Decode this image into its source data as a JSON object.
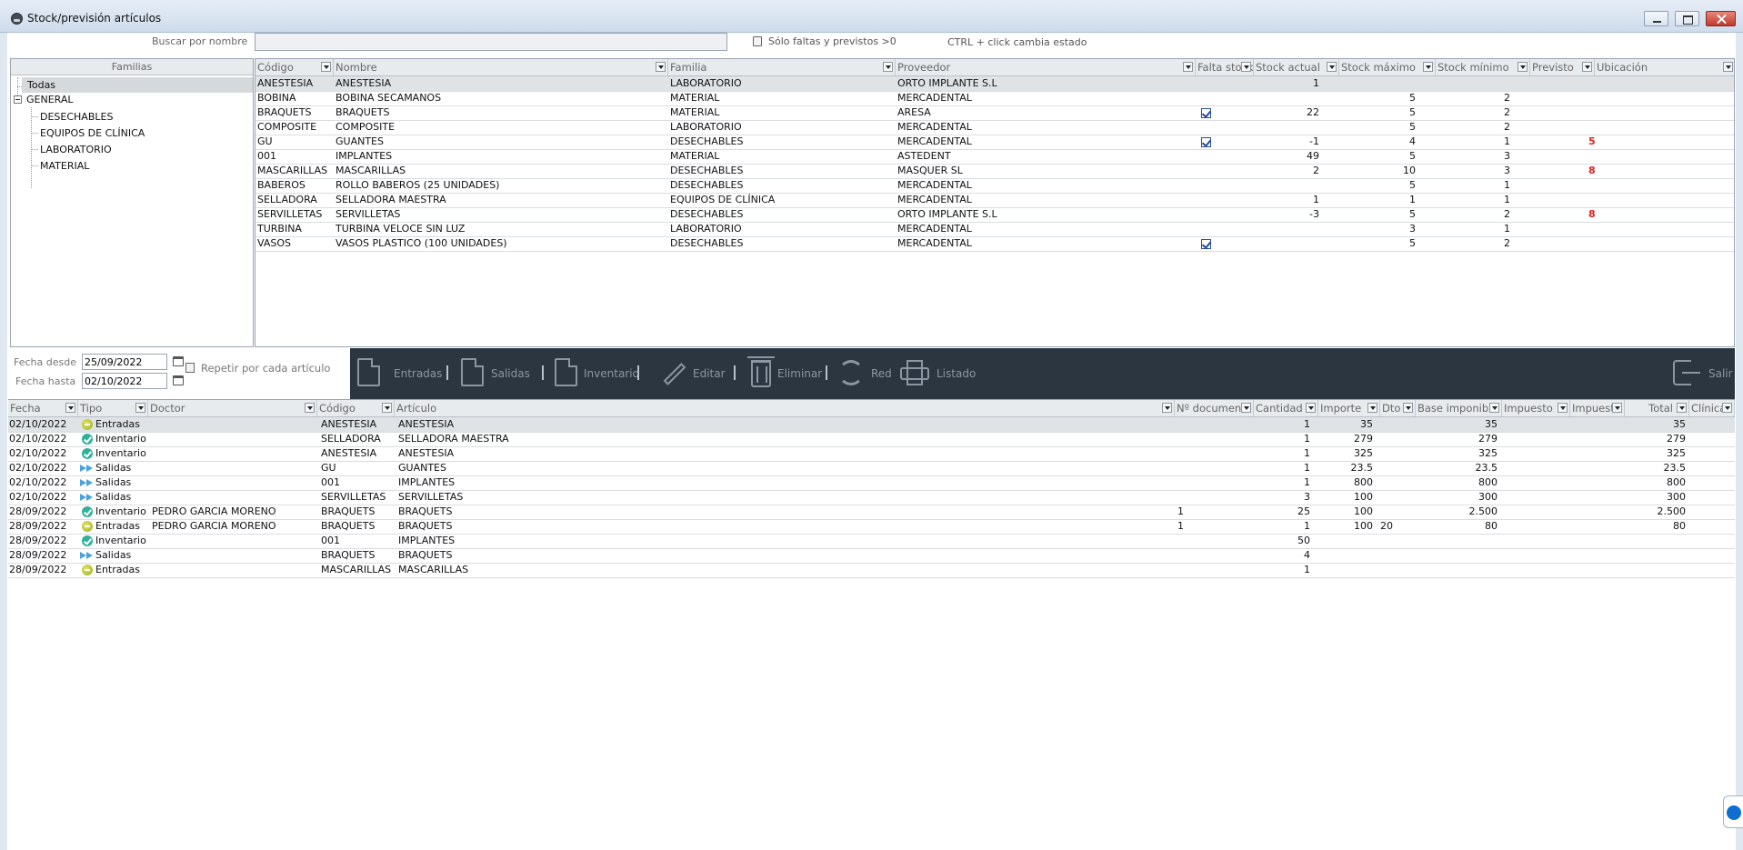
{
  "window": {
    "title": "Stock/previsión artículos"
  },
  "search": {
    "label": "Buscar por nombre",
    "value": "",
    "placeholder": ""
  },
  "filter_faltas_label": "Sólo faltas y previstos >0",
  "ctrl_hint": "CTRL + click cambia estado",
  "families": {
    "header": "Familias",
    "todas": "Todas",
    "general": "GENERAL",
    "children": [
      "DESECHABLES",
      "EQUIPOS DE CLÍNICA",
      "LABORATORIO",
      "MATERIAL"
    ]
  },
  "stock_table": {
    "columns": [
      "Código",
      "Nombre",
      "Familia",
      "Proveedor",
      "Falta stock",
      "Stock actual",
      "Stock máximo",
      "Stock mínimo",
      "Previsto",
      "Ubicación"
    ],
    "rows": [
      {
        "codigo": "ANESTESIA",
        "nombre": "ANESTESIA",
        "familia": "LABORATORIO",
        "proveedor": "ORTO IMPLANTE S.L",
        "falta": false,
        "actual": "1",
        "maximo": "",
        "minimo": "",
        "previsto": ""
      },
      {
        "codigo": "BOBINA",
        "nombre": "BOBINA SECAMANOS",
        "familia": "MATERIAL",
        "proveedor": "MERCADENTAL",
        "falta": false,
        "actual": "",
        "maximo": "5",
        "minimo": "2",
        "previsto": ""
      },
      {
        "codigo": "BRAQUETS",
        "nombre": "BRAQUETS",
        "familia": "MATERIAL",
        "proveedor": "ARESA",
        "falta": true,
        "actual": "22",
        "maximo": "5",
        "minimo": "2",
        "previsto": ""
      },
      {
        "codigo": "COMPOSITE",
        "nombre": "COMPOSITE",
        "familia": "LABORATORIO",
        "proveedor": "MERCADENTAL",
        "falta": false,
        "actual": "",
        "maximo": "5",
        "minimo": "2",
        "previsto": ""
      },
      {
        "codigo": "GU",
        "nombre": "GUANTES",
        "familia": "DESECHABLES",
        "proveedor": "MERCADENTAL",
        "falta": true,
        "actual": "-1",
        "maximo": "4",
        "minimo": "1",
        "previsto": "5"
      },
      {
        "codigo": "001",
        "nombre": "IMPLANTES",
        "familia": "MATERIAL",
        "proveedor": "ASTEDENT",
        "falta": false,
        "actual": "49",
        "maximo": "5",
        "minimo": "3",
        "previsto": ""
      },
      {
        "codigo": "MASCARILLAS",
        "nombre": "MASCARILLAS",
        "familia": "DESECHABLES",
        "proveedor": "MASQUER SL",
        "falta": false,
        "actual": "2",
        "maximo": "10",
        "minimo": "3",
        "previsto": "8"
      },
      {
        "codigo": "BABEROS",
        "nombre": "ROLLO BABEROS (25 UNIDADES)",
        "familia": "DESECHABLES",
        "proveedor": "MERCADENTAL",
        "falta": false,
        "actual": "",
        "maximo": "5",
        "minimo": "1",
        "previsto": ""
      },
      {
        "codigo": "SELLADORA",
        "nombre": "SELLADORA MAESTRA",
        "familia": "EQUIPOS DE CLÍNICA",
        "proveedor": "MERCADENTAL",
        "falta": false,
        "actual": "1",
        "maximo": "1",
        "minimo": "1",
        "previsto": ""
      },
      {
        "codigo": "SERVILLETAS",
        "nombre": "SERVILLETAS",
        "familia": "DESECHABLES",
        "proveedor": "ORTO IMPLANTE S.L",
        "falta": false,
        "actual": "-3",
        "maximo": "5",
        "minimo": "2",
        "previsto": "8"
      },
      {
        "codigo": "TURBINA",
        "nombre": "TURBINA VELOCE SIN LUZ",
        "familia": "LABORATORIO",
        "proveedor": "MERCADENTAL",
        "falta": false,
        "actual": "",
        "maximo": "3",
        "minimo": "1",
        "previsto": ""
      },
      {
        "codigo": "VASOS",
        "nombre": "VASOS PLASTICO (100 UNIDADES)",
        "familia": "DESECHABLES",
        "proveedor": "MERCADENTAL",
        "falta": true,
        "actual": "",
        "maximo": "5",
        "minimo": "2",
        "previsto": ""
      }
    ]
  },
  "filters": {
    "desde_label": "Fecha desde",
    "desde_value": "25/09/2022",
    "hasta_label": "Fecha hasta",
    "hasta_value": "02/10/2022",
    "repetir_label": "Repetir por cada artículo"
  },
  "toolbar": {
    "entradas": "Entradas",
    "salidas": "Salidas",
    "inventario": "Inventario",
    "editar": "Editar",
    "eliminar": "Eliminar",
    "red": "Red",
    "listado": "Listado",
    "salir": "Salir"
  },
  "movements_table": {
    "columns": [
      "Fecha",
      "Tipo",
      "Doctor",
      "Código",
      "Artículo",
      "Nº documento",
      "Cantidad",
      "Importe",
      "Dto",
      "Base imponible",
      "Impuesto",
      "Impuesto",
      "Total",
      "Clínica"
    ],
    "rows": [
      {
        "fecha": "02/10/2022",
        "tipo": "Entradas",
        "doctor": "",
        "codigo": "ANESTESIA",
        "articulo": "ANESTESIA",
        "doc": "",
        "cantidad": "1",
        "importe": "35",
        "dto": "",
        "base": "35",
        "total": "35"
      },
      {
        "fecha": "02/10/2022",
        "tipo": "Inventario",
        "doctor": "",
        "codigo": "SELLADORA",
        "articulo": "SELLADORA MAESTRA",
        "doc": "",
        "cantidad": "1",
        "importe": "279",
        "dto": "",
        "base": "279",
        "total": "279"
      },
      {
        "fecha": "02/10/2022",
        "tipo": "Inventario",
        "doctor": "",
        "codigo": "ANESTESIA",
        "articulo": "ANESTESIA",
        "doc": "",
        "cantidad": "1",
        "importe": "325",
        "dto": "",
        "base": "325",
        "total": "325"
      },
      {
        "fecha": "02/10/2022",
        "tipo": "Salidas",
        "doctor": "",
        "codigo": "GU",
        "articulo": "GUANTES",
        "doc": "",
        "cantidad": "1",
        "importe": "23.5",
        "dto": "",
        "base": "23.5",
        "total": "23.5"
      },
      {
        "fecha": "02/10/2022",
        "tipo": "Salidas",
        "doctor": "",
        "codigo": "001",
        "articulo": "IMPLANTES",
        "doc": "",
        "cantidad": "1",
        "importe": "800",
        "dto": "",
        "base": "800",
        "total": "800"
      },
      {
        "fecha": "02/10/2022",
        "tipo": "Salidas",
        "doctor": "",
        "codigo": "SERVILLETAS",
        "articulo": "SERVILLETAS",
        "doc": "",
        "cantidad": "3",
        "importe": "100",
        "dto": "",
        "base": "300",
        "total": "300"
      },
      {
        "fecha": "28/09/2022",
        "tipo": "Inventario",
        "doctor": "PEDRO GARCIA MORENO",
        "codigo": "BRAQUETS",
        "articulo": "BRAQUETS",
        "doc": "1",
        "cantidad": "25",
        "importe": "100",
        "dto": "",
        "base": "2.500",
        "total": "2.500"
      },
      {
        "fecha": "28/09/2022",
        "tipo": "Entradas",
        "doctor": "PEDRO GARCIA MORENO",
        "codigo": "BRAQUETS",
        "articulo": "BRAQUETS",
        "doc": "1",
        "cantidad": "1",
        "importe": "100",
        "dto": "20",
        "base": "80",
        "total": "80"
      },
      {
        "fecha": "28/09/2022",
        "tipo": "Inventario",
        "doctor": "",
        "codigo": "001",
        "articulo": "IMPLANTES",
        "doc": "",
        "cantidad": "50",
        "importe": "",
        "dto": "",
        "base": "",
        "total": ""
      },
      {
        "fecha": "28/09/2022",
        "tipo": "Salidas",
        "doctor": "",
        "codigo": "BRAQUETS",
        "articulo": "BRAQUETS",
        "doc": "",
        "cantidad": "4",
        "importe": "",
        "dto": "",
        "base": "",
        "total": ""
      },
      {
        "fecha": "28/09/2022",
        "tipo": "Entradas",
        "doctor": "",
        "codigo": "MASCARILLAS",
        "articulo": "MASCARILLAS",
        "doc": "",
        "cantidad": "1",
        "importe": "",
        "dto": "",
        "base": "",
        "total": ""
      }
    ]
  },
  "colors": {
    "toolbar_bg": "#2c3640",
    "selected_row": "#e0e3e6",
    "alert": "#e02020"
  }
}
